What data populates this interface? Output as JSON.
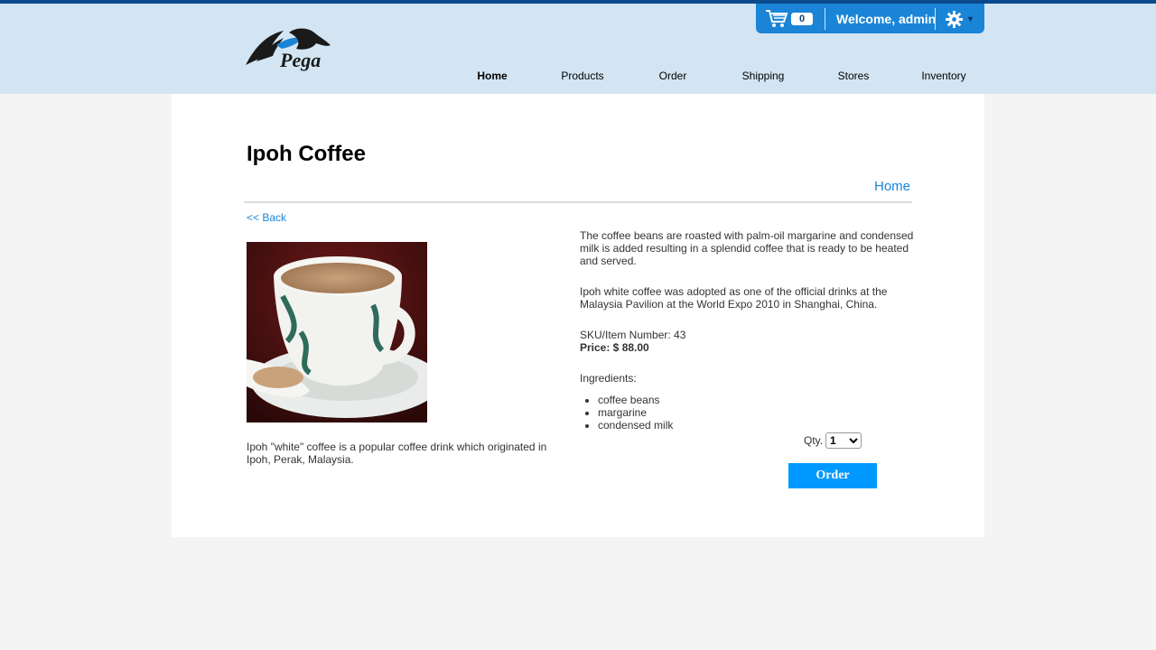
{
  "brand": {
    "logo_text": "Pega"
  },
  "userbar": {
    "cart_count": "0",
    "welcome": "Welcome, admin"
  },
  "nav": {
    "items": [
      "Home",
      "Products",
      "Order",
      "Shipping",
      "Stores",
      "Inventory"
    ],
    "active": "Home"
  },
  "product": {
    "title": "Ipoh Coffee",
    "home_link": "Home",
    "back_link": "<< Back",
    "caption": "Ipoh \"white\" coffee is a popular coffee drink which originated in Ipoh, Perak, Malaysia.",
    "desc1": "The coffee beans are roasted with palm-oil margarine and condensed milk is added resulting in a splendid coffee that is ready to be heated and served.",
    "desc2": "Ipoh white coffee was adopted as one of the official drinks at the Malaysia Pavilion at the World Expo 2010 in Shanghai, China.",
    "sku": "SKU/Item Number: 43",
    "price": "Price: $ 88.00",
    "ingredients_label": "Ingredients:",
    "ingredients": [
      "coffee beans",
      "margarine",
      "condensed milk"
    ],
    "qty_label": "Qty.",
    "qty_value": "1",
    "order_button": "Order"
  },
  "colors": {
    "accent": "#1a85d6",
    "header_bg": "#d3e5f3",
    "order_button": "#0099ff"
  }
}
